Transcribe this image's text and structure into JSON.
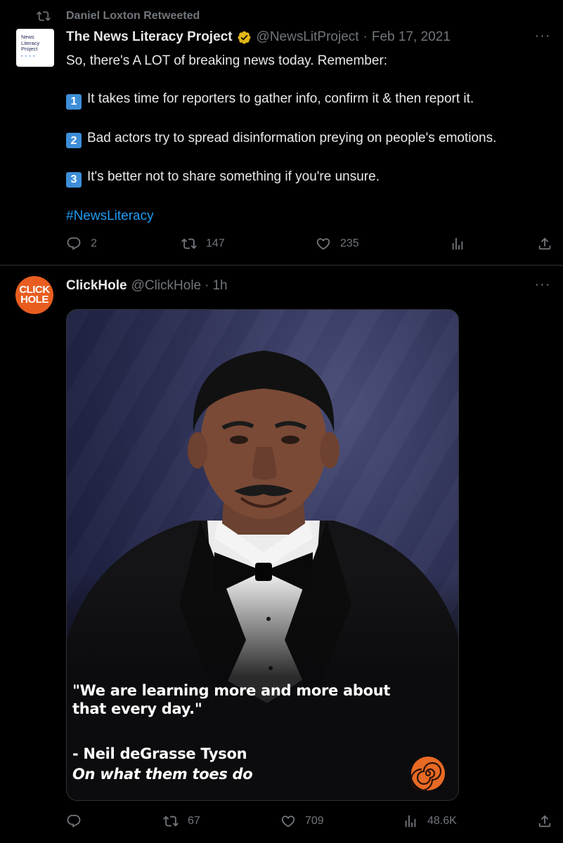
{
  "tweet1": {
    "retweet_label": "Daniel Loxton Retweeted",
    "avatar_text": "News Literacy Project",
    "name": "The News Literacy Project",
    "handle": "@NewsLitProject",
    "separator": "·",
    "date": "Feb 17, 2021",
    "more": "···",
    "intro": "So, there's A LOT of breaking news today. Remember:",
    "points": [
      {
        "num": "1",
        "text": "It takes time for reporters to gather info, confirm it & then report it."
      },
      {
        "num": "2",
        "text": "Bad actors try to spread disinformation preying on people's emotions."
      },
      {
        "num": "3",
        "text": "It's better not to share something if you're unsure."
      }
    ],
    "hashtag": "#NewsLiteracy",
    "actions": {
      "replies": "2",
      "retweets": "147",
      "likes": "235"
    }
  },
  "tweet2": {
    "avatar_line1": "CLICK",
    "avatar_line2": "HOLE",
    "name": "ClickHole",
    "handle": "@ClickHole",
    "separator": "·",
    "time": "1h",
    "more": "···",
    "media": {
      "quote": "\"We are learning more and more about that every day.\"",
      "attribution": "- Neil deGrasse Tyson",
      "subtitle": "On what them toes do"
    },
    "actions": {
      "replies": "",
      "retweets": "67",
      "likes": "709",
      "views": "48.6K"
    }
  },
  "colors": {
    "background": "#000000",
    "text": "#e7e9ea",
    "muted": "#71767b",
    "link": "#1d9bf0",
    "verified": "#e2b719",
    "clickhole": "#e85d1f"
  },
  "icons": [
    "retweet-icon",
    "verified-badge-icon",
    "more-icon",
    "reply-icon",
    "like-icon",
    "analytics-icon",
    "share-icon"
  ]
}
